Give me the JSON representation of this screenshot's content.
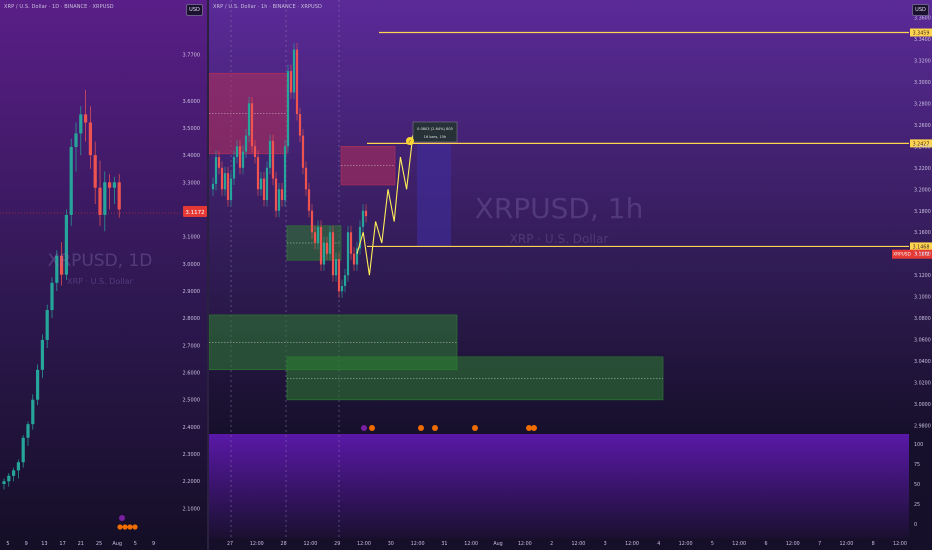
{
  "left_chart": {
    "header": "XRP / U.S. Dollar · 1D · BINANCE · XRPUSD",
    "currency": "USD",
    "watermark_symbol": "XRPUSD, 1D",
    "watermark_name": "XRP · U.S. Dollar",
    "price_tag": "3.1172",
    "colors": {
      "bg_top": "#5a1e88",
      "bg_bottom": "#140e26",
      "up": "#26a69a",
      "down": "#ef5350",
      "tag": "#e53935"
    }
  },
  "right_chart": {
    "header": "XRP / U.S. Dollar · 1h · BINANCE · XRPUSD",
    "currency": "USD",
    "watermark_symbol": "XRPUSD, 1h",
    "watermark_name": "XRP · U.S. Dollar",
    "levels": [
      {
        "label": "3.3459",
        "price": 3.3459
      },
      {
        "label": "3.2427",
        "price": 3.2427
      },
      {
        "label": "3.1468",
        "price": 3.1468
      }
    ],
    "current_price_label": "3.1172",
    "current_price_symbol": "XRPUSD",
    "target_box": {
      "line1": "0.0803 (2.64%) 805",
      "line2": "16 bars, 15h"
    },
    "colors": {
      "bg_top": "#5b2a98",
      "bg_bottom": "#150f2a",
      "level": "#ffd54f",
      "zigzag": "#ffee58",
      "supply": "#b5305a",
      "demand": "#2e7d32"
    }
  },
  "chart_data": [
    {
      "type": "candlestick",
      "title": "XRPUSD, 1D",
      "y_axis_ticks": [
        "3.7700",
        "3.6000",
        "3.5000",
        "3.4000",
        "3.3000",
        "3.2000",
        "3.1000",
        "3.0000",
        "2.9000",
        "2.8000",
        "2.7000",
        "2.6000",
        "2.5000",
        "2.4000",
        "2.3000",
        "2.2000",
        "2.1000"
      ],
      "ylim": [
        2.05,
        3.82
      ],
      "x_axis_ticks": [
        "5",
        "9",
        "13",
        "17",
        "21",
        "25",
        "Aug",
        "5",
        "9"
      ],
      "ohlc_approx": [
        [
          2.19,
          2.21,
          2.17,
          2.2
        ],
        [
          2.2,
          2.23,
          2.18,
          2.22
        ],
        [
          2.22,
          2.25,
          2.2,
          2.24
        ],
        [
          2.24,
          2.28,
          2.21,
          2.27
        ],
        [
          2.27,
          2.37,
          2.25,
          2.36
        ],
        [
          2.36,
          2.42,
          2.33,
          2.41
        ],
        [
          2.41,
          2.52,
          2.39,
          2.5
        ],
        [
          2.5,
          2.63,
          2.48,
          2.61
        ],
        [
          2.61,
          2.74,
          2.58,
          2.72
        ],
        [
          2.72,
          2.85,
          2.69,
          2.83
        ],
        [
          2.83,
          2.95,
          2.8,
          2.93
        ],
        [
          2.93,
          3.05,
          2.9,
          3.03
        ],
        [
          3.03,
          3.08,
          2.92,
          2.96
        ],
        [
          2.96,
          3.2,
          2.94,
          3.18
        ],
        [
          3.18,
          3.46,
          3.14,
          3.43
        ],
        [
          3.43,
          3.52,
          3.34,
          3.48
        ],
        [
          3.48,
          3.58,
          3.4,
          3.55
        ],
        [
          3.55,
          3.64,
          3.45,
          3.52
        ],
        [
          3.52,
          3.58,
          3.35,
          3.4
        ],
        [
          3.4,
          3.45,
          3.22,
          3.28
        ],
        [
          3.28,
          3.38,
          3.14,
          3.18
        ],
        [
          3.18,
          3.34,
          3.12,
          3.3
        ],
        [
          3.3,
          3.33,
          3.2,
          3.28
        ],
        [
          3.28,
          3.32,
          3.22,
          3.3
        ],
        [
          3.3,
          3.33,
          3.17,
          3.2
        ]
      ]
    },
    {
      "type": "candlestick",
      "title": "XRPUSD, 1h",
      "y_axis_ticks": [
        "3.3600",
        "3.3400",
        "3.3200",
        "3.3000",
        "3.2800",
        "3.2600",
        "3.2400",
        "3.2200",
        "3.2000",
        "3.1800",
        "3.1600",
        "3.1400",
        "3.1200",
        "3.1000",
        "3.0800",
        "3.0600",
        "3.0400",
        "3.0200",
        "3.0000",
        "2.9800"
      ],
      "ylim": [
        2.975,
        3.365
      ],
      "x_axis_ticks": [
        "27",
        "12:00",
        "28",
        "12:00",
        "29",
        "12:00",
        "30",
        "12:00",
        "31",
        "12:00",
        "Aug",
        "12:00",
        "2",
        "12:00",
        "3",
        "12:00",
        "4",
        "12:00",
        "5",
        "12:00",
        "6",
        "12:00",
        "7",
        "12:00",
        "8",
        "12:00"
      ],
      "volume_axis_ticks": [
        "100",
        "75",
        "50",
        "25",
        "0"
      ],
      "projection_path": [
        3.14,
        3.16,
        3.12,
        3.17,
        3.15,
        3.2,
        3.17,
        3.23,
        3.2,
        3.25
      ]
    }
  ]
}
